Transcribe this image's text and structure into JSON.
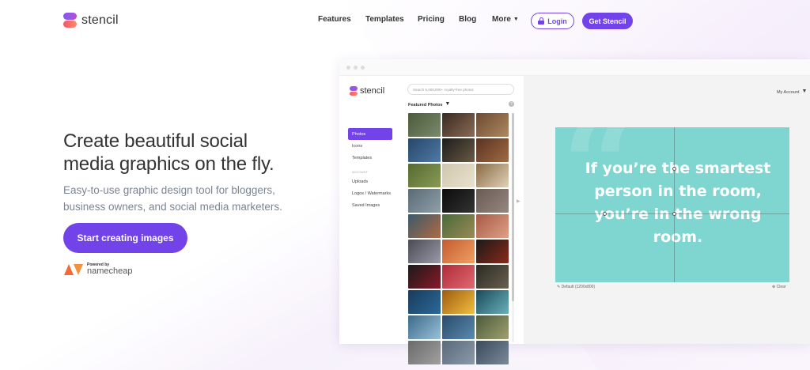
{
  "nav": {
    "brand": "stencil",
    "links": [
      "Features",
      "Templates",
      "Pricing",
      "Blog",
      "More"
    ],
    "login_label": "Login",
    "get_label": "Get Stencil"
  },
  "hero": {
    "title_line1": "Create beautiful social",
    "title_line2": "media graphics on the fly.",
    "sub_line1": "Easy-to-use graphic design tool for bloggers,",
    "sub_line2": "business owners, and social media marketers.",
    "cta_label": "Start creating images",
    "powered_by": "Powered by",
    "partner": "namecheap"
  },
  "app": {
    "brand": "stencil",
    "search_placeholder": "Search 5,000,000+ royalty-free photos",
    "featured_label": "Featured Photos",
    "account_label": "My Account",
    "sidebar": {
      "items": [
        "Photos",
        "Icons",
        "Templates"
      ],
      "section_label": "ACCOUNT",
      "account_items": [
        "Uploads",
        "Logos / Watermarks",
        "Saved Images"
      ]
    },
    "design": {
      "quote": "If you’re the smartest person in the room, you’re in the wrong room.",
      "background_color": "#7fd5d0"
    },
    "size_label": "Default (1200x800)",
    "clear_label": "Clear"
  },
  "colors": {
    "accent": "#7143e8",
    "canvas": "#7fd5d0",
    "partner_orange": "#f26a36"
  }
}
